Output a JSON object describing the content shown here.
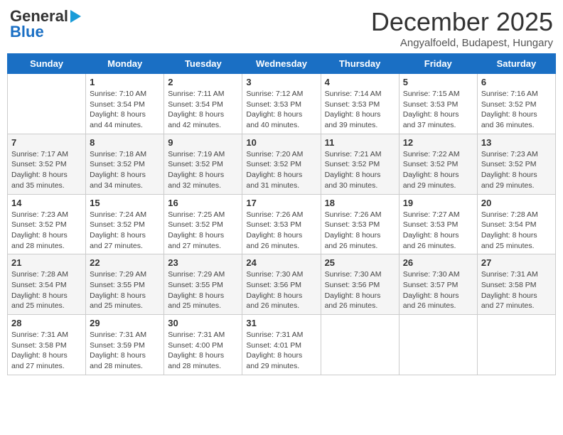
{
  "header": {
    "logo_general": "General",
    "logo_blue": "Blue",
    "month": "December 2025",
    "location": "Angyalfoeld, Budapest, Hungary"
  },
  "days_of_week": [
    "Sunday",
    "Monday",
    "Tuesday",
    "Wednesday",
    "Thursday",
    "Friday",
    "Saturday"
  ],
  "weeks": [
    [
      {
        "day": "",
        "info": ""
      },
      {
        "day": "1",
        "info": "Sunrise: 7:10 AM\nSunset: 3:54 PM\nDaylight: 8 hours\nand 44 minutes."
      },
      {
        "day": "2",
        "info": "Sunrise: 7:11 AM\nSunset: 3:54 PM\nDaylight: 8 hours\nand 42 minutes."
      },
      {
        "day": "3",
        "info": "Sunrise: 7:12 AM\nSunset: 3:53 PM\nDaylight: 8 hours\nand 40 minutes."
      },
      {
        "day": "4",
        "info": "Sunrise: 7:14 AM\nSunset: 3:53 PM\nDaylight: 8 hours\nand 39 minutes."
      },
      {
        "day": "5",
        "info": "Sunrise: 7:15 AM\nSunset: 3:53 PM\nDaylight: 8 hours\nand 37 minutes."
      },
      {
        "day": "6",
        "info": "Sunrise: 7:16 AM\nSunset: 3:52 PM\nDaylight: 8 hours\nand 36 minutes."
      }
    ],
    [
      {
        "day": "7",
        "info": "Sunrise: 7:17 AM\nSunset: 3:52 PM\nDaylight: 8 hours\nand 35 minutes."
      },
      {
        "day": "8",
        "info": "Sunrise: 7:18 AM\nSunset: 3:52 PM\nDaylight: 8 hours\nand 34 minutes."
      },
      {
        "day": "9",
        "info": "Sunrise: 7:19 AM\nSunset: 3:52 PM\nDaylight: 8 hours\nand 32 minutes."
      },
      {
        "day": "10",
        "info": "Sunrise: 7:20 AM\nSunset: 3:52 PM\nDaylight: 8 hours\nand 31 minutes."
      },
      {
        "day": "11",
        "info": "Sunrise: 7:21 AM\nSunset: 3:52 PM\nDaylight: 8 hours\nand 30 minutes."
      },
      {
        "day": "12",
        "info": "Sunrise: 7:22 AM\nSunset: 3:52 PM\nDaylight: 8 hours\nand 29 minutes."
      },
      {
        "day": "13",
        "info": "Sunrise: 7:23 AM\nSunset: 3:52 PM\nDaylight: 8 hours\nand 29 minutes."
      }
    ],
    [
      {
        "day": "14",
        "info": "Sunrise: 7:23 AM\nSunset: 3:52 PM\nDaylight: 8 hours\nand 28 minutes."
      },
      {
        "day": "15",
        "info": "Sunrise: 7:24 AM\nSunset: 3:52 PM\nDaylight: 8 hours\nand 27 minutes."
      },
      {
        "day": "16",
        "info": "Sunrise: 7:25 AM\nSunset: 3:52 PM\nDaylight: 8 hours\nand 27 minutes."
      },
      {
        "day": "17",
        "info": "Sunrise: 7:26 AM\nSunset: 3:53 PM\nDaylight: 8 hours\nand 26 minutes."
      },
      {
        "day": "18",
        "info": "Sunrise: 7:26 AM\nSunset: 3:53 PM\nDaylight: 8 hours\nand 26 minutes."
      },
      {
        "day": "19",
        "info": "Sunrise: 7:27 AM\nSunset: 3:53 PM\nDaylight: 8 hours\nand 26 minutes."
      },
      {
        "day": "20",
        "info": "Sunrise: 7:28 AM\nSunset: 3:54 PM\nDaylight: 8 hours\nand 25 minutes."
      }
    ],
    [
      {
        "day": "21",
        "info": "Sunrise: 7:28 AM\nSunset: 3:54 PM\nDaylight: 8 hours\nand 25 minutes."
      },
      {
        "day": "22",
        "info": "Sunrise: 7:29 AM\nSunset: 3:55 PM\nDaylight: 8 hours\nand 25 minutes."
      },
      {
        "day": "23",
        "info": "Sunrise: 7:29 AM\nSunset: 3:55 PM\nDaylight: 8 hours\nand 25 minutes."
      },
      {
        "day": "24",
        "info": "Sunrise: 7:30 AM\nSunset: 3:56 PM\nDaylight: 8 hours\nand 26 minutes."
      },
      {
        "day": "25",
        "info": "Sunrise: 7:30 AM\nSunset: 3:56 PM\nDaylight: 8 hours\nand 26 minutes."
      },
      {
        "day": "26",
        "info": "Sunrise: 7:30 AM\nSunset: 3:57 PM\nDaylight: 8 hours\nand 26 minutes."
      },
      {
        "day": "27",
        "info": "Sunrise: 7:31 AM\nSunset: 3:58 PM\nDaylight: 8 hours\nand 27 minutes."
      }
    ],
    [
      {
        "day": "28",
        "info": "Sunrise: 7:31 AM\nSunset: 3:58 PM\nDaylight: 8 hours\nand 27 minutes."
      },
      {
        "day": "29",
        "info": "Sunrise: 7:31 AM\nSunset: 3:59 PM\nDaylight: 8 hours\nand 28 minutes."
      },
      {
        "day": "30",
        "info": "Sunrise: 7:31 AM\nSunset: 4:00 PM\nDaylight: 8 hours\nand 28 minutes."
      },
      {
        "day": "31",
        "info": "Sunrise: 7:31 AM\nSunset: 4:01 PM\nDaylight: 8 hours\nand 29 minutes."
      },
      {
        "day": "",
        "info": ""
      },
      {
        "day": "",
        "info": ""
      },
      {
        "day": "",
        "info": ""
      }
    ]
  ]
}
